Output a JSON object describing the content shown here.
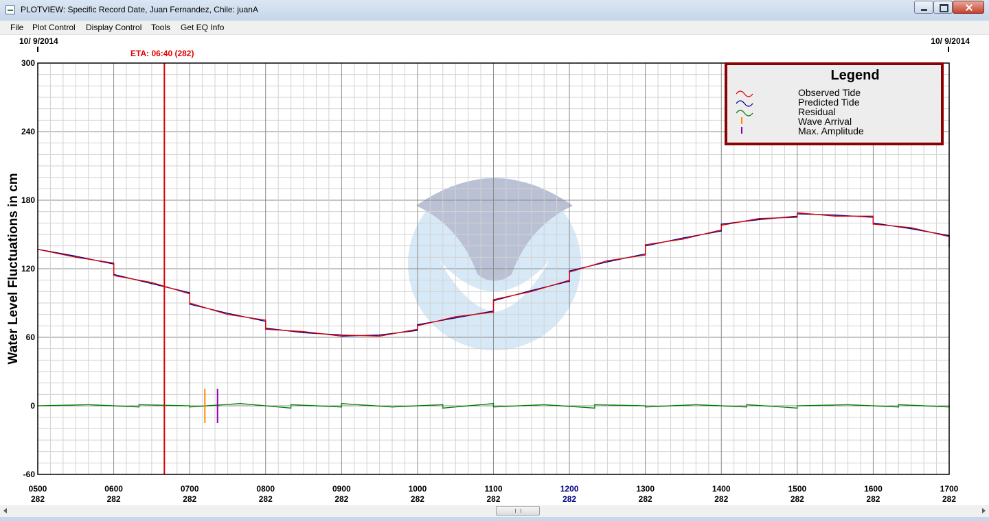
{
  "window": {
    "title": "PLOTVIEW: Specific Record Date, Juan Fernandez, Chile: juanA"
  },
  "menu": {
    "items": [
      "File",
      "Plot Control",
      "Display Control",
      "Tools",
      "Get EQ Info"
    ]
  },
  "colors": {
    "observed": "#e00000",
    "predicted": "#00008b",
    "residual": "#008000",
    "wave_arrival": "#ff8c00",
    "max_amplitude": "#8b00b0",
    "eta_line": "#e00000",
    "legend_border": "#8b0000",
    "highlight_tick": "#000080"
  },
  "chart_data": {
    "type": "line",
    "ylabel": "Water Level Fluctuations in cm",
    "ylim": [
      -60,
      300
    ],
    "yticks": [
      -60,
      0,
      60,
      120,
      180,
      240,
      300
    ],
    "xlim": [
      500,
      1700
    ],
    "xticks": [
      {
        "time": "0500",
        "day": "282"
      },
      {
        "time": "0600",
        "day": "282"
      },
      {
        "time": "0700",
        "day": "282"
      },
      {
        "time": "0800",
        "day": "282"
      },
      {
        "time": "0900",
        "day": "282"
      },
      {
        "time": "1000",
        "day": "282"
      },
      {
        "time": "1100",
        "day": "282"
      },
      {
        "time": "1200",
        "day": "282",
        "highlight": true
      },
      {
        "time": "1300",
        "day": "282"
      },
      {
        "time": "1400",
        "day": "282"
      },
      {
        "time": "1500",
        "day": "282"
      },
      {
        "time": "1600",
        "day": "282"
      },
      {
        "time": "1700",
        "day": "282"
      }
    ],
    "date_left": "10/ 9/2014",
    "date_right": "10/ 9/2014",
    "grid": true,
    "eta": {
      "label": "ETA: 06:40 (282)",
      "time": 640
    },
    "wave_arrival": {
      "time": 712,
      "ymin": -15,
      "ymax": 15
    },
    "max_amplitude": {
      "time": 722,
      "ymin": -15,
      "ymax": 15
    },
    "legend": {
      "title": "Legend",
      "placement": "top-right",
      "entries": [
        "Observed Tide",
        "Predicted Tide",
        "Residual",
        "Wave Arrival",
        "Max. Amplitude"
      ]
    },
    "series": [
      {
        "name": "Predicted Tide",
        "x": [
          500,
          530,
          560,
          600,
          630,
          660,
          700,
          730,
          760,
          800,
          830,
          860,
          900,
          930,
          960,
          1000,
          1030,
          1060,
          1100,
          1130,
          1160,
          1200,
          1230,
          1260,
          1300,
          1330,
          1360,
          1400,
          1430,
          1460,
          1500,
          1530,
          1560,
          1600,
          1630,
          1660,
          1700
        ],
        "y": [
          137,
          131,
          124,
          115,
          107,
          99,
          89,
          81,
          74,
          68,
          64,
          62,
          61,
          62,
          66,
          71,
          77,
          83,
          92,
          101,
          109,
          118,
          126,
          133,
          140,
          147,
          153,
          159,
          163,
          166,
          168,
          167,
          165,
          160,
          155,
          149,
          140
        ]
      },
      {
        "name": "Observed Tide",
        "x": [
          500,
          530,
          560,
          600,
          630,
          660,
          700,
          730,
          760,
          800,
          830,
          860,
          900,
          930,
          960,
          1000,
          1030,
          1060,
          1100,
          1130,
          1160,
          1200,
          1230,
          1260,
          1300,
          1330,
          1360,
          1400,
          1430,
          1460,
          1500,
          1530,
          1560,
          1600,
          1630,
          1660,
          1700
        ],
        "y": [
          137,
          130,
          125,
          114,
          108,
          98,
          90,
          80,
          75,
          67,
          65,
          61,
          62,
          61,
          67,
          70,
          78,
          82,
          93,
          100,
          110,
          117,
          127,
          132,
          141,
          146,
          154,
          158,
          164,
          165,
          169,
          166,
          166,
          159,
          156,
          148,
          139
        ]
      },
      {
        "name": "Residual",
        "x": [
          500,
          540,
          580,
          620,
          660,
          700,
          740,
          780,
          820,
          860,
          900,
          940,
          980,
          1020,
          1060,
          1100,
          1140,
          1180,
          1220,
          1260,
          1300,
          1340,
          1380,
          1420,
          1460,
          1500,
          1540,
          1580,
          1620,
          1660,
          1700
        ],
        "y": [
          0,
          1,
          -1,
          1,
          0,
          -1,
          2,
          -2,
          1,
          -1,
          2,
          -1,
          1,
          -2,
          2,
          -1,
          1,
          -2,
          1,
          0,
          -1,
          1,
          -1,
          1,
          -2,
          0,
          1,
          -1,
          1,
          -1,
          0
        ]
      }
    ]
  }
}
